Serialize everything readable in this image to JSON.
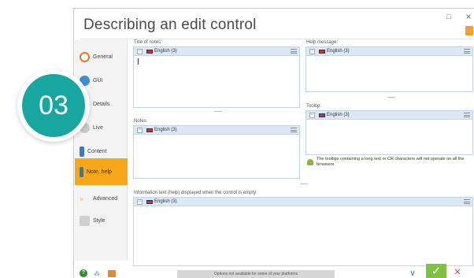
{
  "window": {
    "title": "Describing an edit control",
    "max_glyph": "□",
    "close_glyph": "×"
  },
  "nav": {
    "items": [
      {
        "label": "General",
        "icon": "general-icon"
      },
      {
        "label": "GUI",
        "icon": "gui-icon"
      },
      {
        "label": "Details",
        "icon": "details-icon"
      },
      {
        "label": "Live",
        "icon": "live-icon"
      },
      {
        "label": "Content",
        "icon": "content-icon"
      },
      {
        "label": "Note, help",
        "icon": "note-icon",
        "active": true
      },
      {
        "label": "Advanced",
        "icon": "advanced-icon"
      },
      {
        "label": "Style",
        "icon": "style-icon"
      }
    ]
  },
  "fields": {
    "title_of_notes": {
      "label": "Title of notes:",
      "lang": "English (3)"
    },
    "help_message": {
      "label": "Help message:",
      "lang": "English (3)"
    },
    "tooltip": {
      "label": "Tooltip:",
      "lang": "English (3)"
    },
    "notes": {
      "label": "Notes:",
      "lang": "English (3)"
    },
    "information_text": {
      "label": "Information text (help) displayed when the control is empty:",
      "lang": "English (3)"
    }
  },
  "tooltip_warning": "The tooltips containing a long text or CR characters will not operate on all the browsers.",
  "bottom": {
    "status": "Options not available for some of your platforms",
    "help_glyph": "?",
    "tree_glyph": "⁂",
    "down_glyph": "∨",
    "ok_glyph": "✓",
    "cancel_glyph": "✕"
  },
  "step": {
    "number": "03"
  },
  "colors": {
    "accent": "#f8a61a",
    "badge": "#17a7a0",
    "ok": "#7ec242",
    "cancel": "#d84a4a"
  }
}
